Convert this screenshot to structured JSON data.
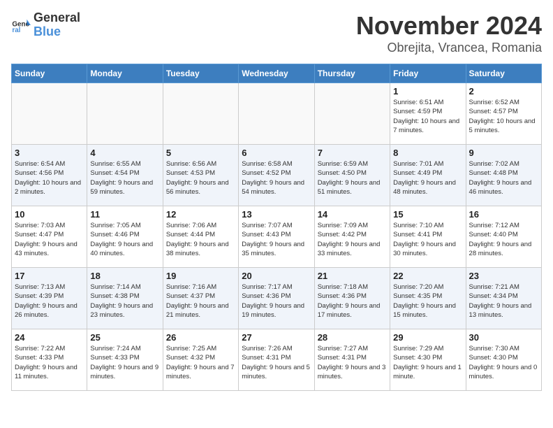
{
  "logo": {
    "general": "General",
    "blue": "Blue"
  },
  "title": "November 2024",
  "location": "Obrejita, Vrancea, Romania",
  "days_of_week": [
    "Sunday",
    "Monday",
    "Tuesday",
    "Wednesday",
    "Thursday",
    "Friday",
    "Saturday"
  ],
  "weeks": [
    [
      {
        "day": "",
        "info": ""
      },
      {
        "day": "",
        "info": ""
      },
      {
        "day": "",
        "info": ""
      },
      {
        "day": "",
        "info": ""
      },
      {
        "day": "",
        "info": ""
      },
      {
        "day": "1",
        "info": "Sunrise: 6:51 AM\nSunset: 4:59 PM\nDaylight: 10 hours and 7 minutes."
      },
      {
        "day": "2",
        "info": "Sunrise: 6:52 AM\nSunset: 4:57 PM\nDaylight: 10 hours and 5 minutes."
      }
    ],
    [
      {
        "day": "3",
        "info": "Sunrise: 6:54 AM\nSunset: 4:56 PM\nDaylight: 10 hours and 2 minutes."
      },
      {
        "day": "4",
        "info": "Sunrise: 6:55 AM\nSunset: 4:54 PM\nDaylight: 9 hours and 59 minutes."
      },
      {
        "day": "5",
        "info": "Sunrise: 6:56 AM\nSunset: 4:53 PM\nDaylight: 9 hours and 56 minutes."
      },
      {
        "day": "6",
        "info": "Sunrise: 6:58 AM\nSunset: 4:52 PM\nDaylight: 9 hours and 54 minutes."
      },
      {
        "day": "7",
        "info": "Sunrise: 6:59 AM\nSunset: 4:50 PM\nDaylight: 9 hours and 51 minutes."
      },
      {
        "day": "8",
        "info": "Sunrise: 7:01 AM\nSunset: 4:49 PM\nDaylight: 9 hours and 48 minutes."
      },
      {
        "day": "9",
        "info": "Sunrise: 7:02 AM\nSunset: 4:48 PM\nDaylight: 9 hours and 46 minutes."
      }
    ],
    [
      {
        "day": "10",
        "info": "Sunrise: 7:03 AM\nSunset: 4:47 PM\nDaylight: 9 hours and 43 minutes."
      },
      {
        "day": "11",
        "info": "Sunrise: 7:05 AM\nSunset: 4:46 PM\nDaylight: 9 hours and 40 minutes."
      },
      {
        "day": "12",
        "info": "Sunrise: 7:06 AM\nSunset: 4:44 PM\nDaylight: 9 hours and 38 minutes."
      },
      {
        "day": "13",
        "info": "Sunrise: 7:07 AM\nSunset: 4:43 PM\nDaylight: 9 hours and 35 minutes."
      },
      {
        "day": "14",
        "info": "Sunrise: 7:09 AM\nSunset: 4:42 PM\nDaylight: 9 hours and 33 minutes."
      },
      {
        "day": "15",
        "info": "Sunrise: 7:10 AM\nSunset: 4:41 PM\nDaylight: 9 hours and 30 minutes."
      },
      {
        "day": "16",
        "info": "Sunrise: 7:12 AM\nSunset: 4:40 PM\nDaylight: 9 hours and 28 minutes."
      }
    ],
    [
      {
        "day": "17",
        "info": "Sunrise: 7:13 AM\nSunset: 4:39 PM\nDaylight: 9 hours and 26 minutes."
      },
      {
        "day": "18",
        "info": "Sunrise: 7:14 AM\nSunset: 4:38 PM\nDaylight: 9 hours and 23 minutes."
      },
      {
        "day": "19",
        "info": "Sunrise: 7:16 AM\nSunset: 4:37 PM\nDaylight: 9 hours and 21 minutes."
      },
      {
        "day": "20",
        "info": "Sunrise: 7:17 AM\nSunset: 4:36 PM\nDaylight: 9 hours and 19 minutes."
      },
      {
        "day": "21",
        "info": "Sunrise: 7:18 AM\nSunset: 4:36 PM\nDaylight: 9 hours and 17 minutes."
      },
      {
        "day": "22",
        "info": "Sunrise: 7:20 AM\nSunset: 4:35 PM\nDaylight: 9 hours and 15 minutes."
      },
      {
        "day": "23",
        "info": "Sunrise: 7:21 AM\nSunset: 4:34 PM\nDaylight: 9 hours and 13 minutes."
      }
    ],
    [
      {
        "day": "24",
        "info": "Sunrise: 7:22 AM\nSunset: 4:33 PM\nDaylight: 9 hours and 11 minutes."
      },
      {
        "day": "25",
        "info": "Sunrise: 7:24 AM\nSunset: 4:33 PM\nDaylight: 9 hours and 9 minutes."
      },
      {
        "day": "26",
        "info": "Sunrise: 7:25 AM\nSunset: 4:32 PM\nDaylight: 9 hours and 7 minutes."
      },
      {
        "day": "27",
        "info": "Sunrise: 7:26 AM\nSunset: 4:31 PM\nDaylight: 9 hours and 5 minutes."
      },
      {
        "day": "28",
        "info": "Sunrise: 7:27 AM\nSunset: 4:31 PM\nDaylight: 9 hours and 3 minutes."
      },
      {
        "day": "29",
        "info": "Sunrise: 7:29 AM\nSunset: 4:30 PM\nDaylight: 9 hours and 1 minute."
      },
      {
        "day": "30",
        "info": "Sunrise: 7:30 AM\nSunset: 4:30 PM\nDaylight: 9 hours and 0 minutes."
      }
    ]
  ]
}
